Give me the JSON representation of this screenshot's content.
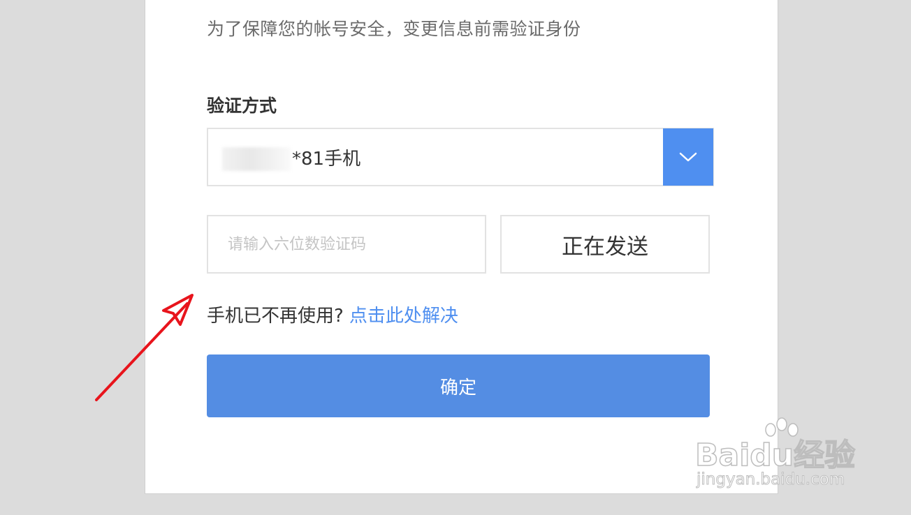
{
  "notice": "为了保障您的帐号安全，变更信息前需验证身份",
  "verify_method": {
    "label": "验证方式",
    "selected_value": "*81手机",
    "dropdown_icon": "chevron-down-icon"
  },
  "code_input": {
    "placeholder": "请输入六位数验证码",
    "value": ""
  },
  "send_button": {
    "label": "正在发送"
  },
  "help": {
    "text": "手机已不再使用?",
    "link": "点击此处解决"
  },
  "confirm_button": {
    "label": "确定"
  },
  "watermark": {
    "brand": "Baidu经验",
    "url": "jingyan.baidu.com"
  },
  "colors": {
    "accent": "#4f8ff0",
    "confirm": "#548de3",
    "annotation_arrow": "#e8141c",
    "background": "#dcdcdc"
  }
}
